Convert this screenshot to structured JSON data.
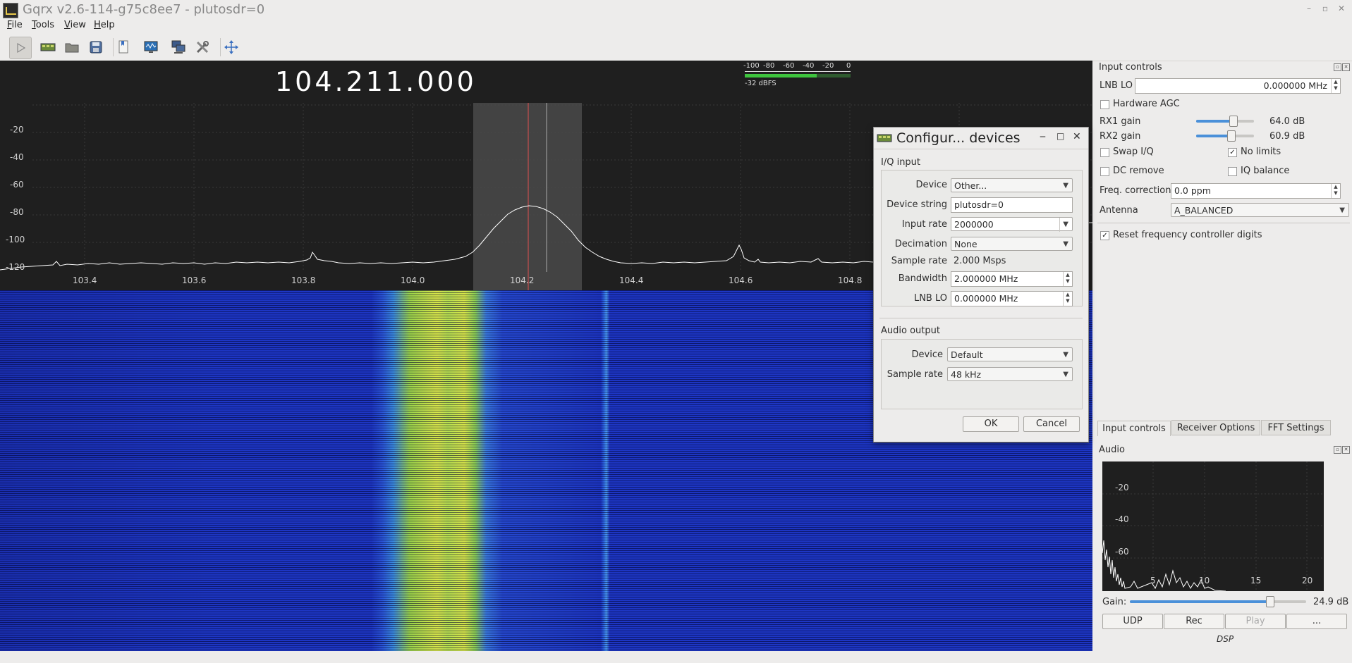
{
  "window": {
    "title": "Gqrx v2.6-114-g75c8ee7 - plutosdr=0",
    "controls": [
      "–",
      "▫",
      "✕"
    ]
  },
  "menu": [
    "File",
    "Tools",
    "View",
    "Help"
  ],
  "main": {
    "frequency": "104.211.000",
    "meter": {
      "scale": [
        "-100",
        "-80",
        "-60",
        "-40",
        "-20",
        "0"
      ],
      "level_text": "-32 dBFS",
      "level_fraction": 0.68
    },
    "plot": {
      "y_ticks": [
        "-20",
        "-40",
        "-60",
        "-80",
        "-100",
        "-120"
      ],
      "x_ticks": [
        "103.4",
        "103.6",
        "103.8",
        "104.0",
        "104.2",
        "104.4",
        "104.6",
        "104.8"
      ]
    }
  },
  "dialog": {
    "title": "Configur... devices",
    "iq_group": "I/Q input",
    "device_label": "Device",
    "device_value": "Other...",
    "device_string_label": "Device string",
    "device_string_value": "plutosdr=0",
    "input_rate_label": "Input rate",
    "input_rate_value": "2000000",
    "decimation_label": "Decimation",
    "decimation_value": "None",
    "sample_rate_label": "Sample rate",
    "sample_rate_value": "2.000 Msps",
    "bandwidth_label": "Bandwidth",
    "bandwidth_value": "2.000000 MHz",
    "lnb_label": "LNB LO",
    "lnb_value": "0.000000 MHz",
    "audio_group": "Audio output",
    "audio_device_label": "Device",
    "audio_device_value": "Default",
    "audio_rate_label": "Sample rate",
    "audio_rate_value": "48 kHz",
    "ok": "OK",
    "cancel": "Cancel"
  },
  "input_controls": {
    "header": "Input controls",
    "lnb_label": "LNB LO",
    "lnb_value": "0.000000 MHz",
    "hw_agc": "Hardware AGC",
    "rx1_label": "RX1 gain",
    "rx1_value": "64.0 dB",
    "rx1_fraction": 0.63,
    "rx2_label": "RX2 gain",
    "rx2_value": "60.9 dB",
    "rx2_fraction": 0.6,
    "swap_iq": "Swap I/Q",
    "no_limits": "No limits",
    "dc_remove": "DC remove",
    "iq_balance": "IQ balance",
    "freq_corr_label": "Freq. correction",
    "freq_corr_value": "0.0 ppm",
    "antenna_label": "Antenna",
    "antenna_value": "A_BALANCED",
    "reset_digits": "Reset frequency controller digits"
  },
  "tabs": [
    "Input controls",
    "Receiver Options",
    "FFT Settings"
  ],
  "audio": {
    "header": "Audio",
    "y_ticks": [
      "-20",
      "-40",
      "-60"
    ],
    "x_ticks": [
      "5",
      "10",
      "15",
      "20"
    ],
    "gain_label": "Gain:",
    "gain_value": "24.9 dB",
    "gain_fraction": 0.79,
    "buttons": [
      "UDP",
      "Rec",
      "Play",
      "..."
    ],
    "dsp_label": "DSP"
  }
}
